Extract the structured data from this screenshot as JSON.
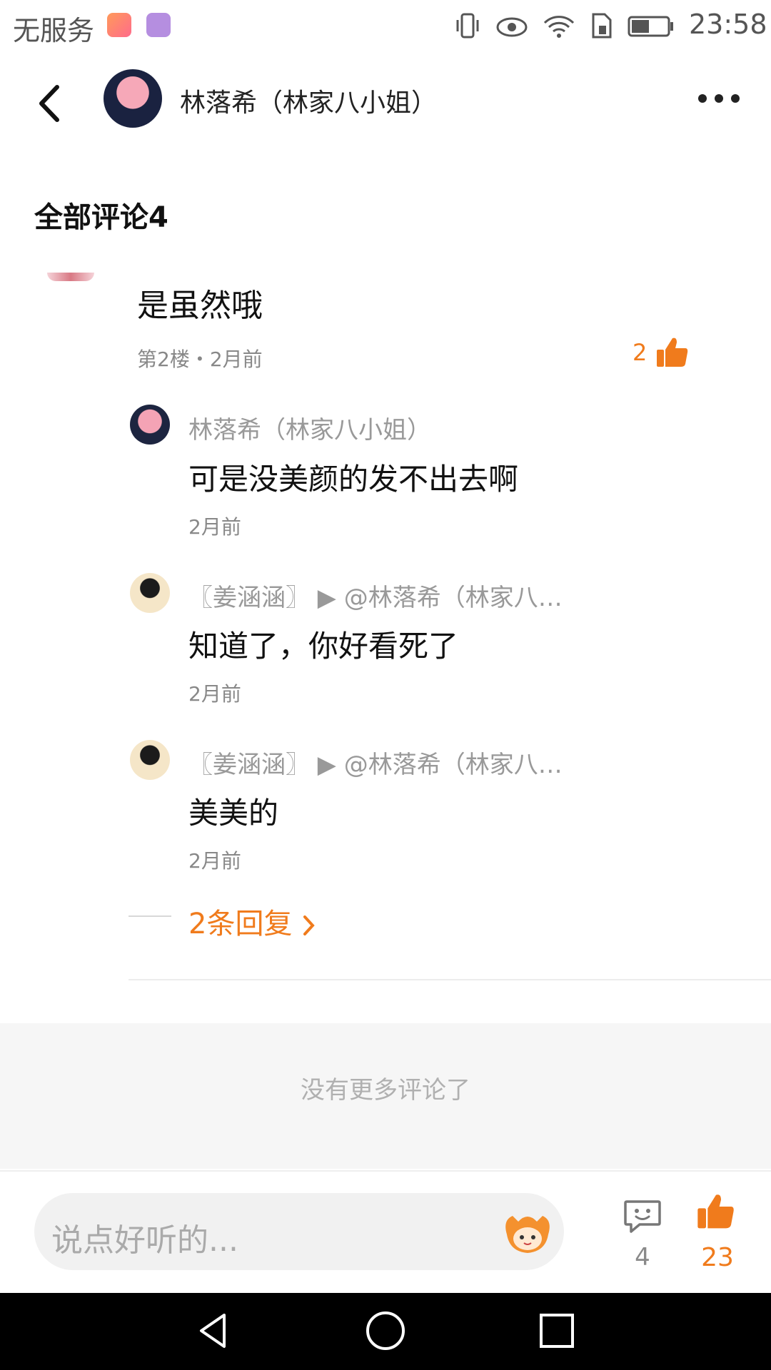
{
  "status_bar": {
    "carrier": "无服务",
    "time": "23:58",
    "icons": [
      "vibrate-icon",
      "eye-icon",
      "wifi-icon",
      "sim-icon",
      "battery-icon"
    ]
  },
  "header": {
    "title": "林落希（林家八小姐）"
  },
  "section": {
    "title": "全部评论4"
  },
  "main_comment": {
    "text": "是虽然哦",
    "meta": "第2楼・2月前",
    "likes": "2"
  },
  "replies": [
    {
      "name": "林落希（林家八小姐）",
      "text": "可是没美颜的发不出去啊",
      "time": "2月前"
    },
    {
      "name": "〖姜涵涵〗 ▶ @林落希（林家八…",
      "text": "知道了，你好看死了",
      "time": "2月前"
    },
    {
      "name": "〖姜涵涵〗 ▶ @林落希（林家八…",
      "text": "美美的",
      "time": "2月前"
    }
  ],
  "more_replies": "2条回复",
  "end_text": "没有更多评论了",
  "input": {
    "placeholder": "说点好听的..."
  },
  "actions": {
    "comment_count": "4",
    "like_count": "23"
  },
  "colors": {
    "accent": "#f07b1c",
    "muted": "#888888"
  }
}
